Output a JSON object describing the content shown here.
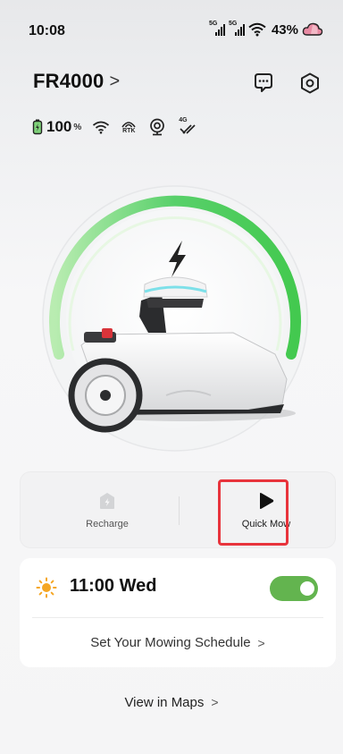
{
  "status_bar": {
    "time": "10:08",
    "sim1": "5G",
    "sim2": "5G",
    "battery_percent": "43%",
    "icons": [
      "signal-icon",
      "signal-icon",
      "wifi-icon",
      "cloud-icon"
    ]
  },
  "header": {
    "device_name": "FR4000",
    "chevron": ">",
    "icons": [
      "message-icon",
      "settings-icon"
    ]
  },
  "device_status": {
    "battery_value": "100",
    "battery_unit": "%",
    "rtk_label": "RTK",
    "cell_label": "4G",
    "icons": [
      "battery-icon",
      "wifi-icon",
      "rtk-icon",
      "gps-icon",
      "cellular-icon"
    ]
  },
  "hero": {
    "charging_level": 1.0,
    "icons": [
      "lightning-icon",
      "mower-image"
    ],
    "colors": {
      "ring_start": "#b9ecb1",
      "ring_end": "#43c94f"
    }
  },
  "actions": {
    "recharge_label": "Recharge",
    "quick_mow_label": "Quick Mow",
    "icons": [
      "home-charge-icon",
      "play-icon"
    ]
  },
  "schedule": {
    "time_label": "11:00 Wed",
    "enabled": true,
    "link_label": "Set Your Mowing Schedule",
    "link_chevron": ">",
    "icons": [
      "sun-icon"
    ],
    "colors": {
      "toggle": "#63b44f",
      "sun": "#f5a623"
    }
  },
  "maps": {
    "link_label": "View in Maps",
    "link_chevron": ">"
  },
  "highlight_color": "#e8343c"
}
